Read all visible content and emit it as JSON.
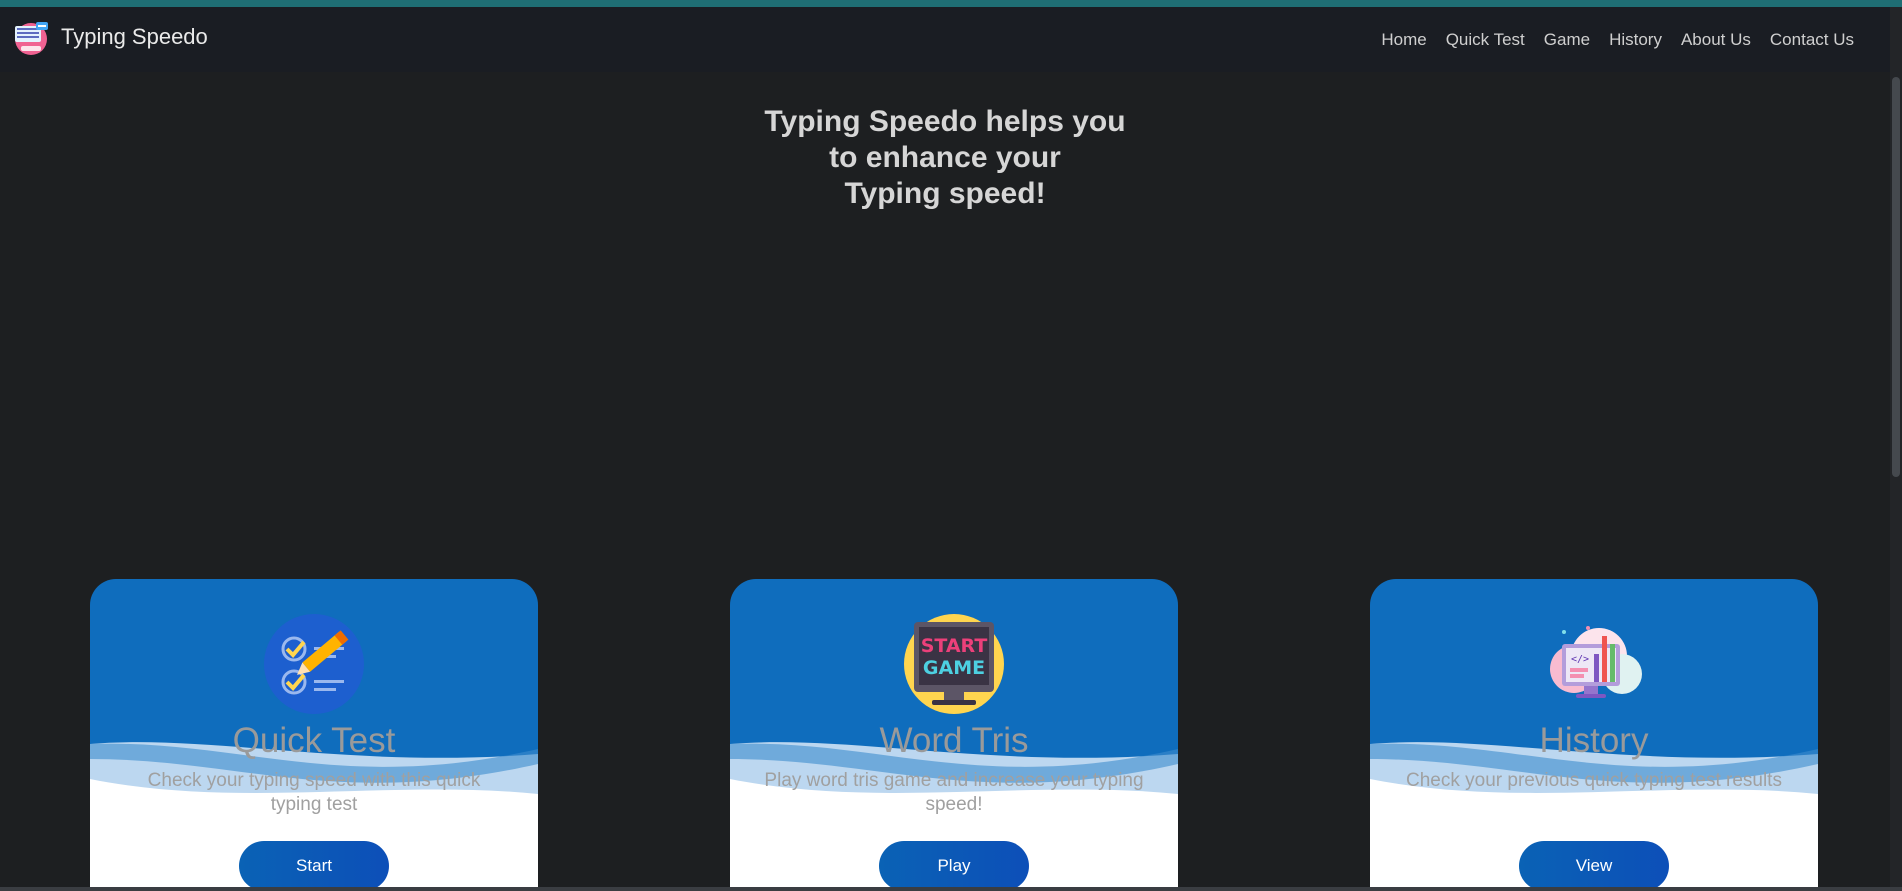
{
  "brand": {
    "name": "Typing Speedo"
  },
  "nav": [
    "Home",
    "Quick Test",
    "Game",
    "History",
    "About Us",
    "Contact Us"
  ],
  "hero": {
    "lines": [
      "Typing Speedo helps you",
      "to enhance your",
      "Typing speed!"
    ]
  },
  "cards": [
    {
      "title": "Quick Test",
      "desc": "Check your typing speed with this quick typing test",
      "button": "Start",
      "icon": "checklist-pencil-icon"
    },
    {
      "title": "Word Tris",
      "desc": "Play word tris game and increase your typing speed!",
      "button": "Play",
      "icon": "start-game-monitor-icon",
      "icon_text": [
        "START",
        "GAME"
      ]
    },
    {
      "title": "History",
      "desc": "Check your previous quick typing test results",
      "button": "View",
      "icon": "analytics-cloud-icon"
    }
  ],
  "colors": {
    "page_bg": "#1d1f21",
    "navbar_bg": "#1a1d23",
    "card_bg": "#0f6dbd",
    "top_accent": "#1f6e74",
    "button": "#0a62b5"
  }
}
